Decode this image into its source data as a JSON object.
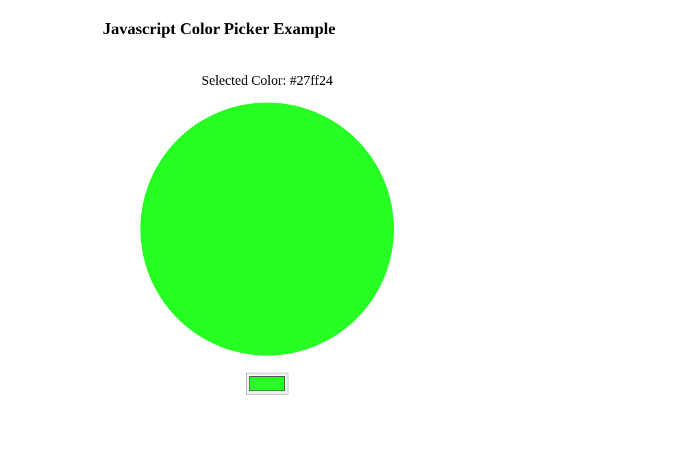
{
  "header": {
    "title": "Javascript Color Picker Example"
  },
  "picker": {
    "label_prefix": "Selected Color: ",
    "selected_hex": "#27ff24"
  }
}
